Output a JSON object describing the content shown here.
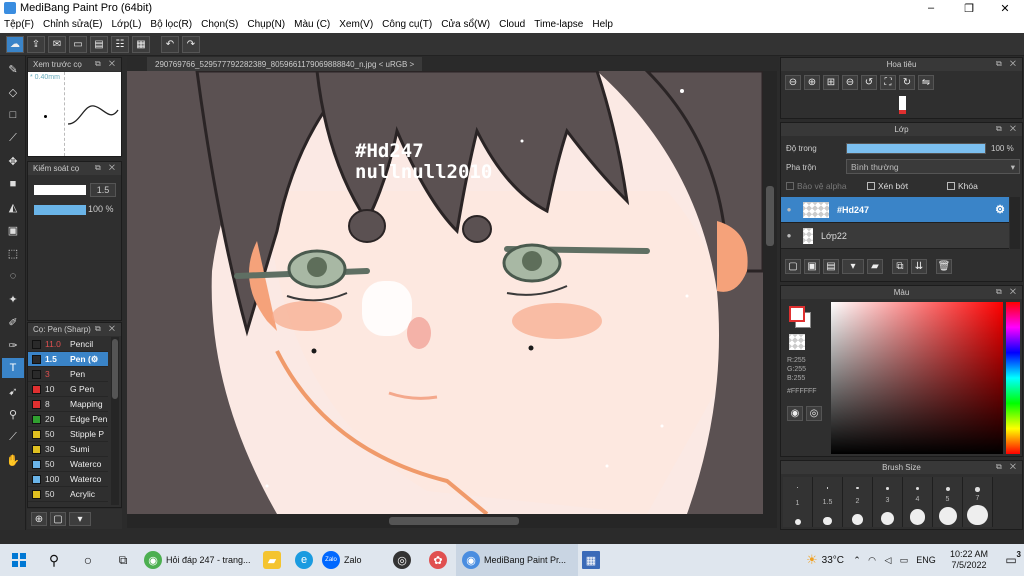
{
  "window": {
    "title": "MediBang Paint Pro (64bit)",
    "controls": [
      "–",
      "❐",
      "✕"
    ]
  },
  "menu": [
    "Tệp(F)",
    "Chỉnh sửa(E)",
    "Lớp(L)",
    "Bộ lọc(R)",
    "Chọn(S)",
    "Chụp(N)",
    "Màu (C)",
    "Xem(V)",
    "Công cụ(T)",
    "Cửa sổ(W)",
    "Cloud",
    "Time-lapse",
    "Help"
  ],
  "document_tab": "290769766_529577792282389_8059661179069888840_n.jpg < uRGB >",
  "navigator_panel": {
    "title": "Xem trước cọ",
    "size_label": "* 0.40mm"
  },
  "brush_control": {
    "title": "Kiểm soát cọ",
    "size_value": "1.5",
    "opacity_value": "100 %",
    "opacity_fraction": 1.0
  },
  "brush_list": {
    "title": "Cọ: Pen (Sharp)",
    "items": [
      {
        "size": "11.0",
        "name": "Pencil",
        "color": "#2a2a2a"
      },
      {
        "size": "1.5",
        "name": "Pen (⚙",
        "color": "#2a2a2a",
        "selected": true
      },
      {
        "size": "3",
        "name": "Pen",
        "color": "#2a2a2a"
      },
      {
        "size": "10",
        "name": "G Pen",
        "color": "#e03030"
      },
      {
        "size": "8",
        "name": "Mapping",
        "color": "#e03030"
      },
      {
        "size": "20",
        "name": "Edge Pen",
        "color": "#30a030"
      },
      {
        "size": "50",
        "name": "Stipple P",
        "color": "#e0c020"
      },
      {
        "size": "30",
        "name": "Sumi",
        "color": "#e0c020"
      },
      {
        "size": "50",
        "name": "Waterco",
        "color": "#6ab4e8"
      },
      {
        "size": "100",
        "name": "Waterco",
        "color": "#6ab4e8"
      },
      {
        "size": "50",
        "name": "Acrylic",
        "color": "#e0c020"
      }
    ]
  },
  "canvas": {
    "watermark_line1": "#Hd247",
    "watermark_line2": "nullnull2010",
    "skin_color": "#fde7df",
    "hair_color": "#5b5152"
  },
  "navigator_right": {
    "title": "Hoa tiêu"
  },
  "layer_panel": {
    "title": "Lớp",
    "opacity_label": "Độ trong",
    "opacity_value": "100 %",
    "opacity_fraction": 1.0,
    "blend_label": "Pha trộn",
    "blend_value": "Bình thường",
    "protect_alpha": "Bảo vệ alpha",
    "clipping": "Xén bớt",
    "lock": "Khóa",
    "layers": [
      {
        "name": "#Hd247",
        "selected": true
      },
      {
        "name": "Lớp22",
        "selected": false
      }
    ]
  },
  "color_panel": {
    "title": "Màu",
    "r": "R:255",
    "g": "G:255",
    "b": "B:255",
    "hex": "#FFFFFF",
    "primary": "#ffffff",
    "secondary": "#e03030"
  },
  "brush_size_panel": {
    "title": "Brush Size",
    "sizes": [
      "1",
      "1.5",
      "2",
      "3",
      "4",
      "5",
      "7"
    ]
  },
  "taskbar": {
    "items": [
      "Hỏi đáp 247 - trang...",
      "Zalo",
      "MediBang Paint Pr..."
    ],
    "temp": "33°C",
    "lang": "ENG",
    "time": "10:22 AM",
    "date": "7/5/2022",
    "notifications": "3"
  },
  "accent": "#3a84c8"
}
